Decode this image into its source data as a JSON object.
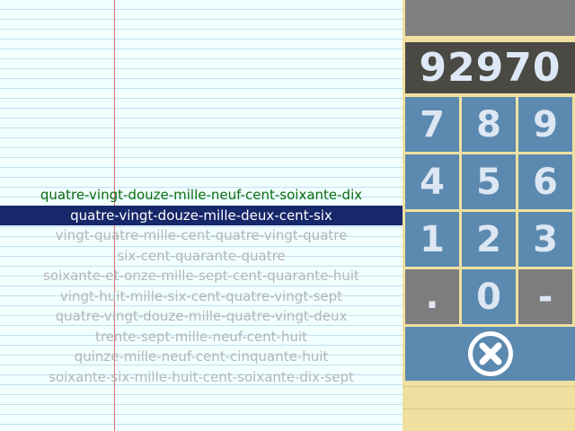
{
  "display": {
    "value": "92970"
  },
  "words": [
    {
      "text": "quatre-vingt-douze-mille-neuf-cent-soixante-dix",
      "state": "correct"
    },
    {
      "text": "quatre-vingt-douze-mille-deux-cent-six",
      "state": "selected"
    },
    {
      "text": "vingt-quatre-mille-cent-quatre-vingt-quatre",
      "state": "normal"
    },
    {
      "text": "six-cent-quarante-quatre",
      "state": "normal"
    },
    {
      "text": "soixante-et-onze-mille-sept-cent-quarante-huit",
      "state": "normal"
    },
    {
      "text": "vingt-huit-mille-six-cent-quatre-vingt-sept",
      "state": "normal"
    },
    {
      "text": "quatre-vingt-douze-mille-quatre-vingt-deux",
      "state": "normal"
    },
    {
      "text": "trente-sept-mille-neuf-cent-huit",
      "state": "normal"
    },
    {
      "text": "quinze-mille-neuf-cent-cinquante-huit",
      "state": "normal"
    },
    {
      "text": "soixante-six-mille-huit-cent-soixante-dix-sept",
      "state": "normal"
    }
  ],
  "keypad": {
    "k7": "7",
    "k8": "8",
    "k9": "9",
    "k4": "4",
    "k5": "5",
    "k6": "6",
    "k1": "1",
    "k2": "2",
    "k3": "3",
    "kdot": ".",
    "k0": "0",
    "kminus": "-",
    "clear_icon": "clear-x-icon"
  },
  "colors": {
    "selected_bg": "#17286a",
    "correct_text": "#0b6b10",
    "key_blue": "#5b89b0",
    "key_gray": "#7d7d7d",
    "display_bg": "#4b4944"
  }
}
